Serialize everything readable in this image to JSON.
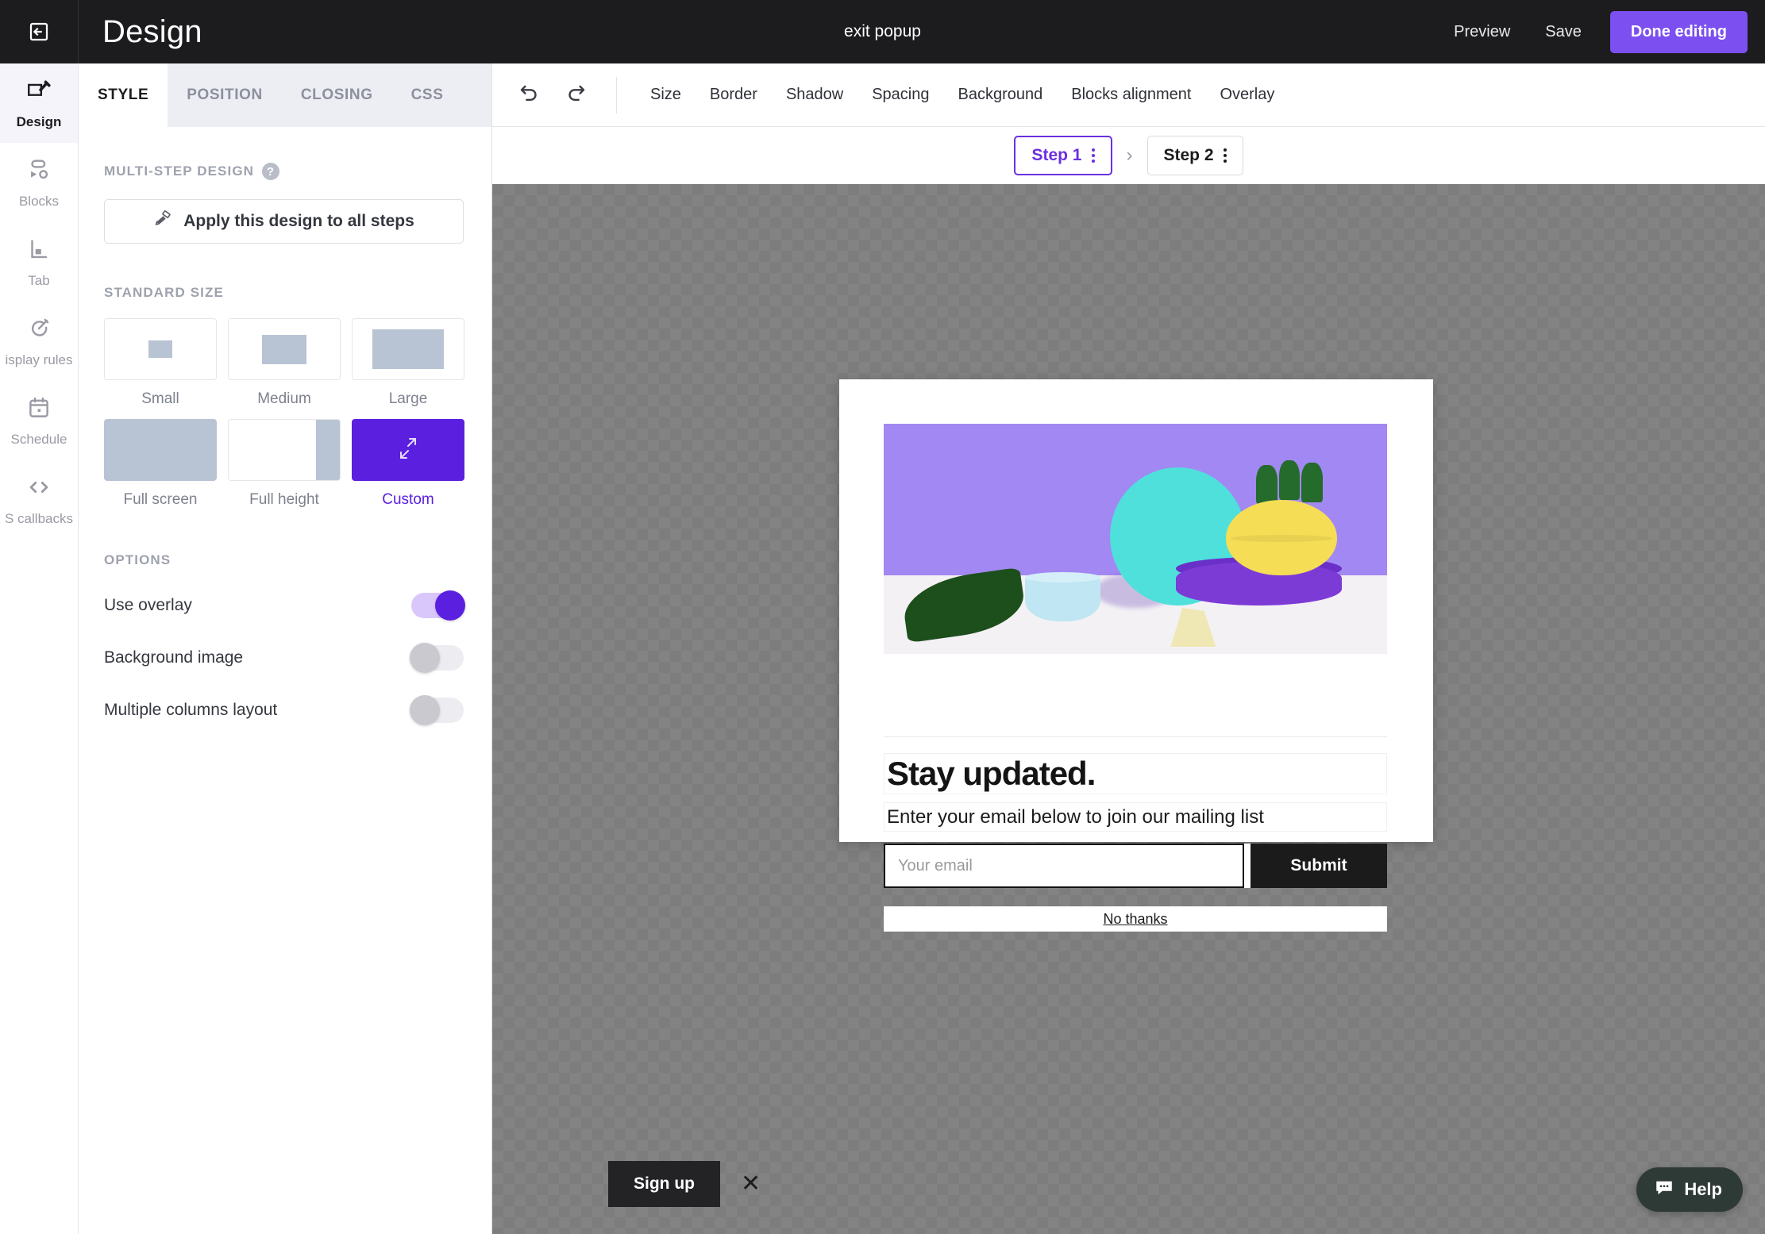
{
  "topbar": {
    "exit_icon": "exit-arrow-icon",
    "app_title": "Design",
    "campaign_name": "exit popup",
    "preview_label": "Preview",
    "save_label": "Save",
    "done_label": "Done editing",
    "primary_color": "#7c4ff0"
  },
  "rail": {
    "items": [
      {
        "label": "Design",
        "icon": "design-brush-icon",
        "active": true
      },
      {
        "label": "Blocks",
        "icon": "blocks-icon",
        "active": false
      },
      {
        "label": "Tab",
        "icon": "tab-icon",
        "active": false
      },
      {
        "label": "isplay rules",
        "icon": "target-icon",
        "active": false
      },
      {
        "label": "Schedule",
        "icon": "calendar-icon",
        "active": false
      },
      {
        "label": "S callbacks",
        "icon": "code-icon",
        "active": false
      }
    ]
  },
  "panel": {
    "tabs": [
      {
        "label": "STYLE",
        "active": true
      },
      {
        "label": "POSITION",
        "active": false
      },
      {
        "label": "CLOSING",
        "active": false
      },
      {
        "label": "CSS",
        "active": false
      }
    ],
    "multistep": {
      "section_label": "MULTI-STEP DESIGN",
      "help_icon": "question-mark-icon",
      "help_glyph": "?",
      "apply_button": "Apply this design to all steps",
      "apply_icon": "paint-roller-icon"
    },
    "standard_size": {
      "section_label": "STANDARD SIZE",
      "options": [
        {
          "label": "Small",
          "selected": false
        },
        {
          "label": "Medium",
          "selected": false
        },
        {
          "label": "Large",
          "selected": false
        },
        {
          "label": "Full screen",
          "selected": false
        },
        {
          "label": "Full height",
          "selected": false
        },
        {
          "label": "Custom",
          "selected": true
        }
      ],
      "selected_color": "#5b1fe0"
    },
    "options": {
      "section_label": "OPTIONS",
      "rows": [
        {
          "label": "Use overlay",
          "on": true
        },
        {
          "label": "Background image",
          "on": false
        },
        {
          "label": "Multiple columns layout",
          "on": false
        }
      ]
    }
  },
  "toolbar": {
    "undo_icon": "undo-icon",
    "redo_icon": "redo-icon",
    "links": [
      "Size",
      "Border",
      "Shadow",
      "Spacing",
      "Background",
      "Blocks alignment",
      "Overlay"
    ]
  },
  "steps": {
    "items": [
      {
        "label": "Step 1",
        "active": true
      },
      {
        "label": "Step 2",
        "active": false
      }
    ],
    "separator": "›",
    "active_color": "#6b2fe0"
  },
  "popup": {
    "image_alt": "purple-background-still-life-photo",
    "heading": "Stay updated.",
    "subheading": "Enter your email below to join our mailing list",
    "email_placeholder": "Your email",
    "email_value": "",
    "submit_label": "Submit",
    "dismiss_label": "No thanks"
  },
  "tab_teaser": {
    "label": "Sign up",
    "close_icon": "close-x-icon",
    "close_glyph": "✕"
  },
  "help": {
    "label": "Help",
    "icon": "chat-bubble-icon"
  }
}
